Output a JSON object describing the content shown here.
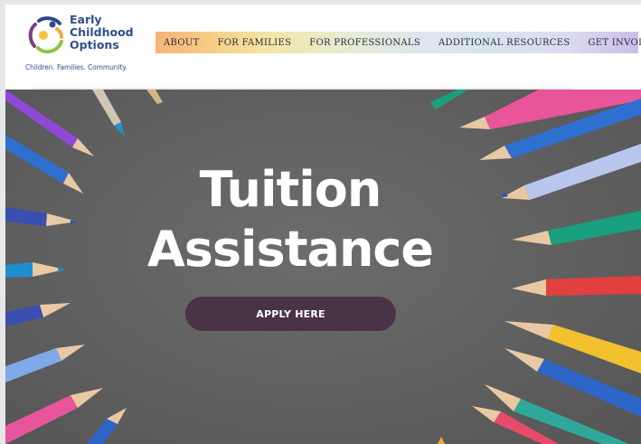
{
  "logo": {
    "line1": "Early",
    "line2": "Childhood",
    "line3": "Options",
    "tagline": "Children. Families. Community."
  },
  "nav": {
    "items": [
      {
        "label": "ABOUT"
      },
      {
        "label": "FOR FAMILIES"
      },
      {
        "label": "FOR PROFESSIONALS"
      },
      {
        "label": "ADDITIONAL RESOURCES"
      },
      {
        "label": "GET INVOLVED"
      }
    ]
  },
  "hero": {
    "title_line1": "Tuition",
    "title_line2": "Assistance",
    "button_label": "APPLY HERE",
    "button_color": "#4a3345",
    "background_color": "#666666"
  },
  "pencil_colors": [
    "#8e4ad4",
    "#2f6fd0",
    "#1f8ecf",
    "#3a4fb0",
    "#7fa9e8",
    "#e8559a",
    "#18a07e",
    "#e2403e",
    "#f2c12e",
    "#2e65c8",
    "#2fa899",
    "#e84a6a"
  ]
}
